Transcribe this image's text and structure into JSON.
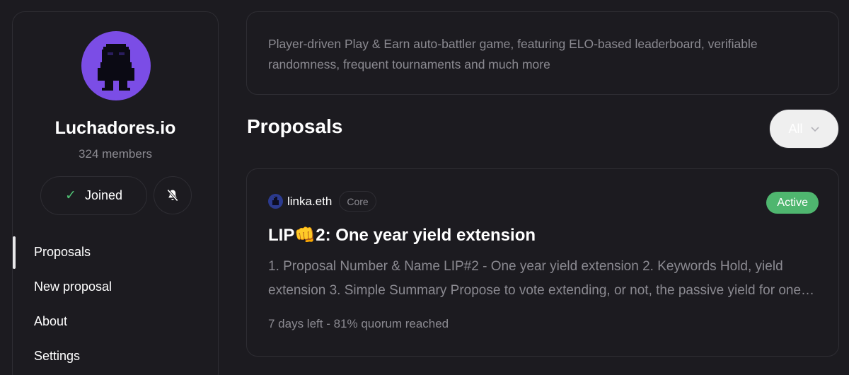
{
  "space": {
    "name": "Luchadores.io",
    "members": "324 members",
    "avatar_icon": "pixel-luchador-avatar",
    "avatar_color": "#7b4de6"
  },
  "actions": {
    "joined_label": "Joined",
    "joined_icon": "check-icon",
    "notifications_icon": "bell-off-icon"
  },
  "nav": {
    "items": [
      {
        "label": "Proposals",
        "active": true
      },
      {
        "label": "New proposal",
        "active": false
      },
      {
        "label": "About",
        "active": false
      },
      {
        "label": "Settings",
        "active": false
      }
    ]
  },
  "about": {
    "text": "Player-driven Play & Earn auto-battler game, featuring ELO-based leaderboard, verifiable randomness, frequent tournaments and much more"
  },
  "proposals": {
    "heading": "Proposals",
    "filter_label": "All",
    "filter_icon": "chevron-down-icon"
  },
  "proposal": {
    "author": "linka.eth",
    "role_badge": "Core",
    "status": "Active",
    "status_color": "#4fb66f",
    "title": "LIP👊2: One year yield extension",
    "body": "1. Proposal Number & Name LIP#2 - One year yield extension 2. Keywords Hold, yield extension 3. Simple Summary Propose to vote extending, or not, the passive yield for one year",
    "meta": "7 days left - 81% quorum reached"
  }
}
